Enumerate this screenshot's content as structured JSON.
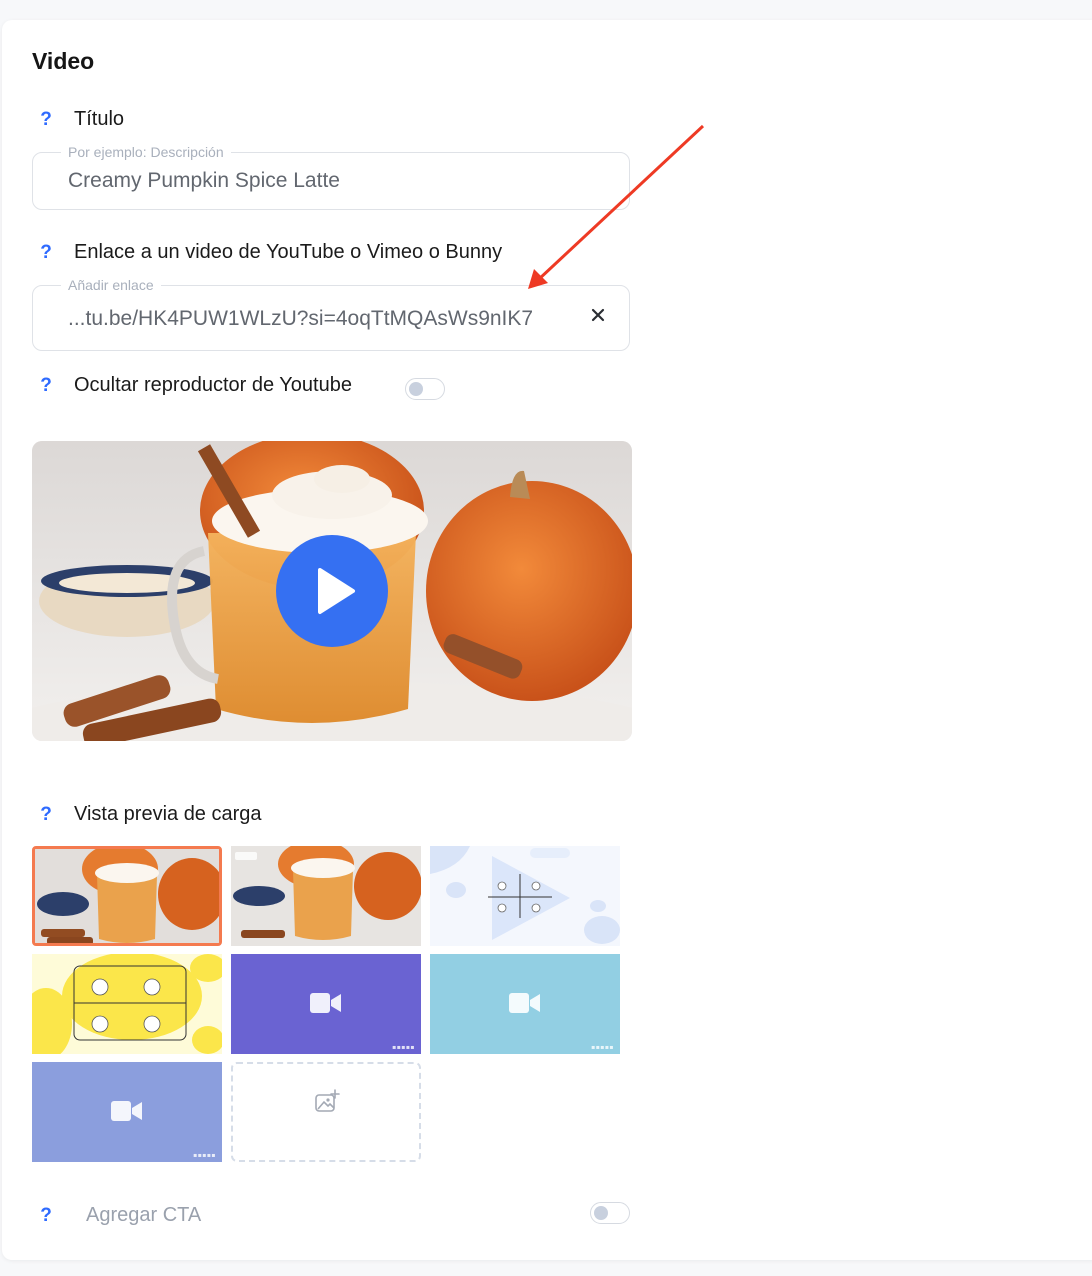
{
  "section": {
    "title": "Video"
  },
  "title_field": {
    "help": "?",
    "label": "Título",
    "placeholder": "Por ejemplo: Descripción",
    "value": "Creamy Pumpkin Spice Latte"
  },
  "link_field": {
    "help": "?",
    "label": "Enlace a un video de YouTube o Vimeo o Bunny",
    "placeholder": "Añadir enlace",
    "value": "...tu.be/HK4PUW1WLzU?si=4oqTtMQAsWs9nIK7",
    "clear_icon": "close-icon"
  },
  "hide_player": {
    "help": "?",
    "label": "Ocultar reproductor de Youtube",
    "enabled": false
  },
  "video": {
    "play_icon": "play-icon",
    "accent": "#3570f2"
  },
  "preview": {
    "help": "?",
    "label": "Vista previa de carga",
    "thumbnails": [
      {
        "kind": "photo",
        "selected": true
      },
      {
        "kind": "photo-text",
        "selected": false
      },
      {
        "kind": "light-blue-pattern",
        "selected": false
      },
      {
        "kind": "yellow-pattern",
        "selected": false
      },
      {
        "kind": "video-purple",
        "color": "#6a63d2",
        "icon": "video-camera-icon",
        "selected": false
      },
      {
        "kind": "video-cyan",
        "color": "#92cfe3",
        "icon": "video-camera-icon",
        "selected": false
      },
      {
        "kind": "video-periwinkle",
        "color": "#8b9edd",
        "icon": "video-camera-icon",
        "selected": false
      },
      {
        "kind": "add",
        "icon": "add-image-icon",
        "selected": false
      }
    ],
    "selected_color": "#f47a4f"
  },
  "cta": {
    "help": "?",
    "label": "Agregar CTA",
    "enabled": false
  }
}
